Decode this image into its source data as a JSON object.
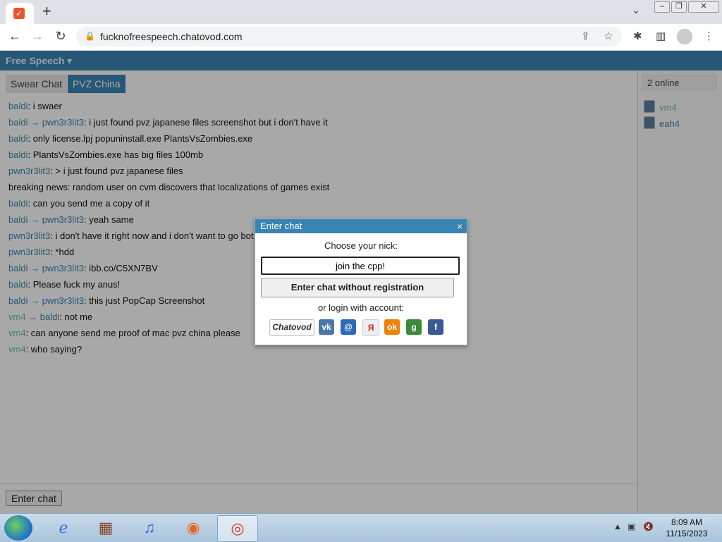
{
  "browser": {
    "url": "fucknofreespeech.chatovod.com",
    "new_tab": "+",
    "window_controls": [
      "–",
      "❐",
      "✕"
    ],
    "icons": {
      "favicon": "chatovod-favicon-icon",
      "back": "back-arrow-icon",
      "forward": "forward-arrow-icon",
      "reload": "reload-icon",
      "lock": "lock-icon",
      "share": "share-icon",
      "star": "bookmark-star-icon",
      "extensions": "extensions-puzzle-icon",
      "sidepanel": "side-panel-icon",
      "profile": "profile-avatar-icon",
      "menu": "kebab-menu-icon"
    }
  },
  "page": {
    "room_title": "Free Speech",
    "tabs": [
      {
        "label": "Swear Chat",
        "active": false
      },
      {
        "label": "PVZ China",
        "active": true
      }
    ],
    "messages": [
      {
        "from": "baldi",
        "to": "",
        "text": "i swaer"
      },
      {
        "from": "baldi",
        "to": "pwn3r3lit3",
        "text": "i just found pvz japanese files screenshot but i don't have it"
      },
      {
        "from": "baldi",
        "to": "",
        "text": "only license.lpj popuninstall.exe PlantsVsZombies.exe"
      },
      {
        "from": "baldi",
        "to": "",
        "text": "PlantsVsZombies.exe has big files 100mb"
      },
      {
        "from": "pwn3r3lit3",
        "to": "",
        "text": "> i just found pvz japanese files"
      },
      {
        "from": "",
        "to": "",
        "text": "breaking news: random user on cvm discovers that localizations of games exist"
      },
      {
        "from": "baldi",
        "to": "",
        "text": "can you send me a copy of it"
      },
      {
        "from": "baldi",
        "to": "pwn3r3lit3",
        "text": "yeah same"
      },
      {
        "from": "pwn3r3lit3",
        "to": "",
        "text": "i don't have it right now and i don't want to go bot"
      },
      {
        "from": "pwn3r3lit3",
        "to": "",
        "text": "*hdd"
      },
      {
        "from": "baldi",
        "to": "pwn3r3lit3",
        "text": "ibb.co/C5XN7BV"
      },
      {
        "from": "baldi",
        "to": "",
        "text": "Please fuck my anus!"
      },
      {
        "from": "baldi",
        "to": "pwn3r3lit3",
        "text": "this just PopCap Screenshot"
      },
      {
        "from": "vm4",
        "to": "baldi",
        "text": "not me"
      },
      {
        "from": "vm4",
        "to": "",
        "text": "can anyone send me proof of mac pvz china please"
      },
      {
        "from": "vm4",
        "to": "",
        "text": "who saying?"
      }
    ],
    "online_count": "2 online",
    "users": [
      "vm4",
      "eah4"
    ],
    "enter_chat_button": "Enter chat",
    "colors": {
      "accent": "#3a84b3",
      "guest_nick": "#69c49d"
    }
  },
  "dialog": {
    "title": "Enter chat",
    "close": "×",
    "choose_nick_label": "Choose your nick:",
    "nick_value": "join the cpp!",
    "guest_button": "Enter chat without registration",
    "login_label": "or login with account:",
    "providers": [
      {
        "name": "chatovod",
        "label": "Chatovod",
        "color": "#fafafa"
      },
      {
        "name": "vkontakte",
        "label": "vk",
        "color": "#4a76a8"
      },
      {
        "name": "mail-ru",
        "label": "@",
        "color": "#2d6ab8"
      },
      {
        "name": "yandex",
        "label": "Я",
        "color": "#eeeeee"
      },
      {
        "name": "odnoklassniki",
        "label": "ok",
        "color": "#ee8208"
      },
      {
        "name": "google",
        "label": "g",
        "color": "#3a8a3a"
      },
      {
        "name": "facebook",
        "label": "f",
        "color": "#3b5998"
      }
    ]
  },
  "taskbar": {
    "apps": [
      "start-orb-icon",
      "internet-explorer-icon",
      "media-library-icon",
      "itunes-icon",
      "firefox-icon",
      "chrome-icon"
    ],
    "time": "8:09 AM",
    "date": "11/15/2023"
  }
}
